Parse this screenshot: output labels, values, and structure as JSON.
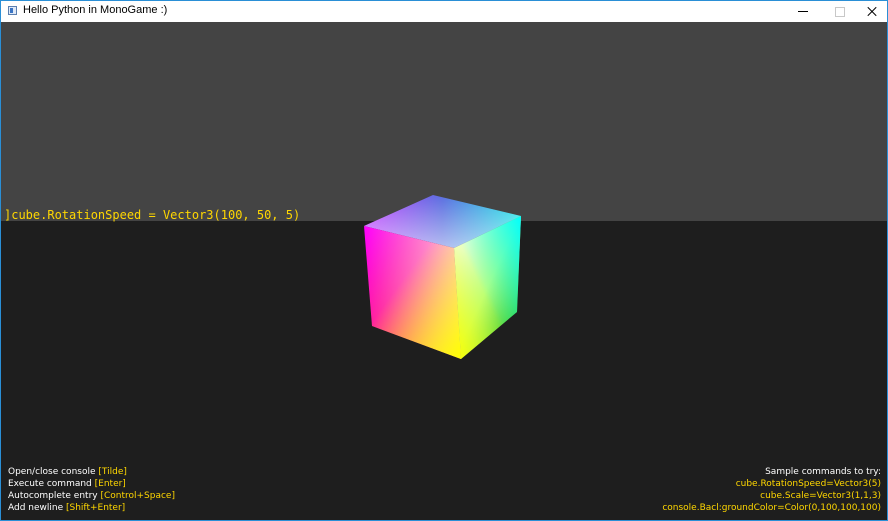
{
  "window": {
    "title": "Hello Python in MonoGame :)",
    "controls": [
      "minimize",
      "maximize",
      "close"
    ]
  },
  "console": {
    "input": "]cube.RotationSpeed = Vector3(100, 50, 5)"
  },
  "help": [
    {
      "text": "Open/close console ",
      "key": "[Tilde]"
    },
    {
      "text": "Execute command ",
      "key": "[Enter]"
    },
    {
      "text": "Autocomplete entry ",
      "key": "[Control+Space]"
    },
    {
      "text": "Add newline ",
      "key": "[Shift+Enter]"
    }
  ],
  "samples": {
    "heading": "Sample commands to try:",
    "commands": [
      "cube.RotationSpeed=Vector3(5)",
      "cube.Scale=Vector3(1,1,3)",
      "console.Bacl:groundColor=Color(0,100,100,100)"
    ]
  },
  "colors": {
    "console_bg": "#444444",
    "scene_bg": "#1e1e1e",
    "accent": "#ffd700",
    "text": "#ffffff"
  }
}
